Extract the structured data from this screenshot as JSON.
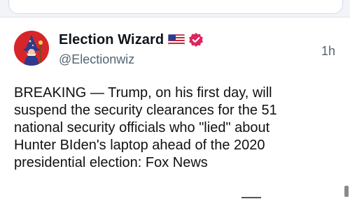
{
  "post": {
    "display_name": "Election Wizard",
    "handle": "@Electionwiz",
    "timestamp": "1h",
    "flag_icon": "us-flag-icon",
    "verified_icon": "verified-badge-icon",
    "verified_color": "#e0245e",
    "text": "BREAKING — Trump, on his first day, will\nsuspend the security clearances for the 51\nnational security officials who \"lied\" about\nHunter BIden's laptop ahead of the 2020\npresidential election: Fox News"
  },
  "avatar": {
    "icon": "wizard-avatar-icon",
    "background": "#d7262a"
  }
}
